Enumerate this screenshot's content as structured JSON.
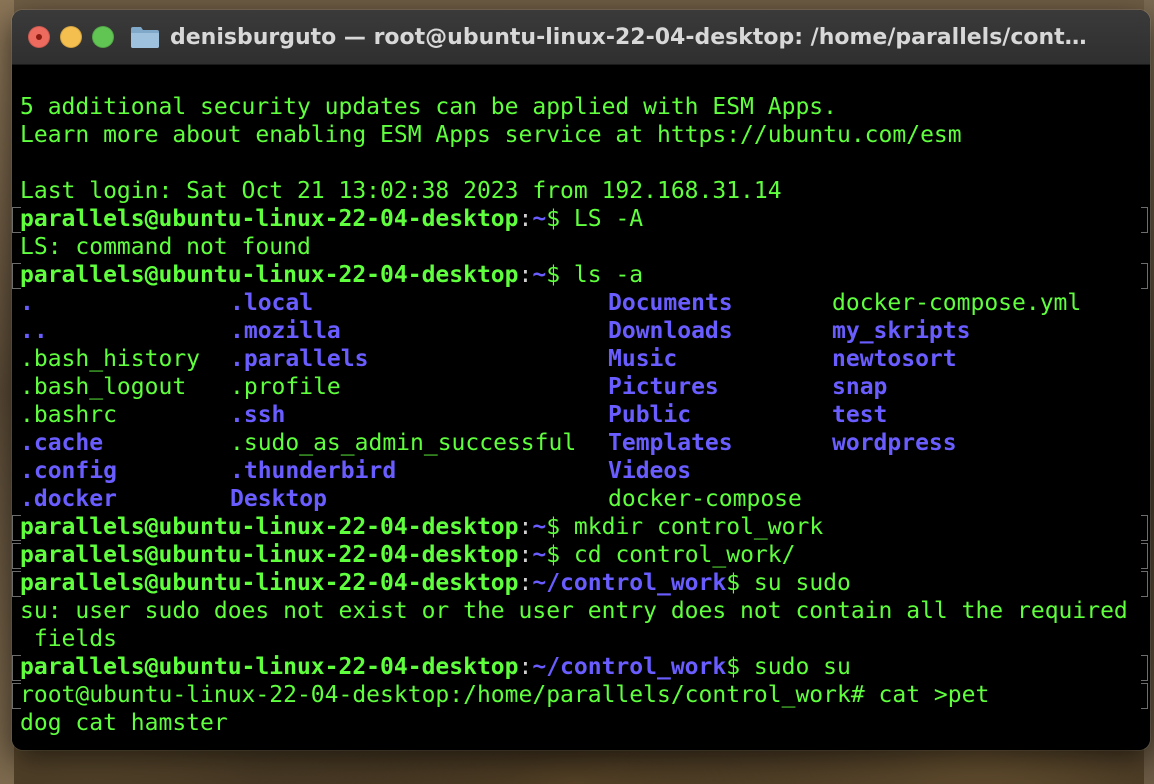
{
  "window": {
    "title": "denisburguto — root@ubuntu-linux-22-04-desktop: /home/parallels/cont…",
    "traffic_lights": [
      "close",
      "minimize",
      "zoom"
    ],
    "icon": "folder-icon"
  },
  "colors": {
    "text_green": "#5fff3e",
    "dir_blue": "#6a5dff",
    "background": "#000000"
  },
  "terminal": {
    "intro": [
      "5 additional security updates can be applied with ESM Apps.",
      "Learn more about enabling ESM Apps service at https://ubuntu.com/esm",
      "",
      "Last login: Sat Oct 21 13:02:38 2023 from 192.168.31.14"
    ],
    "prompts": [
      {
        "user": "parallels@ubuntu-linux-22-04-desktop",
        "path": "~",
        "cmd": "$ LS -A"
      },
      {
        "user": "parallels@ubuntu-linux-22-04-desktop",
        "path": "~",
        "cmd": "$ ls -a"
      },
      {
        "user": "parallels@ubuntu-linux-22-04-desktop",
        "path": "~",
        "cmd": "$ mkdir control_work"
      },
      {
        "user": "parallels@ubuntu-linux-22-04-desktop",
        "path": "~",
        "cmd": "$ cd control_work/"
      },
      {
        "user": "parallels@ubuntu-linux-22-04-desktop",
        "path": "~/control_work",
        "cmd": "$ su sudo"
      },
      {
        "user": "parallels@ubuntu-linux-22-04-desktop",
        "path": "~/control_work",
        "cmd": "$ sudo su"
      }
    ],
    "error_ls": "LS: command not found",
    "ls_columns": {
      "col1": [
        {
          "name": ".",
          "type": "dir"
        },
        {
          "name": "..",
          "type": "dir"
        },
        {
          "name": ".bash_history",
          "type": "file"
        },
        {
          "name": ".bash_logout",
          "type": "file"
        },
        {
          "name": ".bashrc",
          "type": "file"
        },
        {
          "name": ".cache",
          "type": "dir"
        },
        {
          "name": ".config",
          "type": "dir"
        },
        {
          "name": ".docker",
          "type": "dir"
        }
      ],
      "col2": [
        {
          "name": ".local",
          "type": "dir"
        },
        {
          "name": ".mozilla",
          "type": "dir"
        },
        {
          "name": ".parallels",
          "type": "dir"
        },
        {
          "name": ".profile",
          "type": "file"
        },
        {
          "name": ".ssh",
          "type": "dir"
        },
        {
          "name": ".sudo_as_admin_successful",
          "type": "file"
        },
        {
          "name": ".thunderbird",
          "type": "dir"
        },
        {
          "name": "Desktop",
          "type": "dir"
        }
      ],
      "col3": [
        {
          "name": "Documents",
          "type": "dir"
        },
        {
          "name": "Downloads",
          "type": "dir"
        },
        {
          "name": "Music",
          "type": "dir"
        },
        {
          "name": "Pictures",
          "type": "dir"
        },
        {
          "name": "Public",
          "type": "dir"
        },
        {
          "name": "Templates",
          "type": "dir"
        },
        {
          "name": "Videos",
          "type": "dir"
        },
        {
          "name": "docker-compose",
          "type": "file"
        }
      ],
      "col4": [
        {
          "name": "docker-compose.yml",
          "type": "file"
        },
        {
          "name": "my_skripts",
          "type": "dir"
        },
        {
          "name": "newtosort",
          "type": "dir"
        },
        {
          "name": "snap",
          "type": "dir"
        },
        {
          "name": "test",
          "type": "dir"
        },
        {
          "name": "wordpress",
          "type": "dir"
        }
      ]
    },
    "su_error_line1": "su: user sudo does not exist or the user entry does not contain all the required",
    "su_error_line2": " fields",
    "root_prompt": "root@ubuntu-linux-22-04-desktop:/home/parallels/control_work# cat >pet",
    "last_line": "dog cat hamster"
  }
}
